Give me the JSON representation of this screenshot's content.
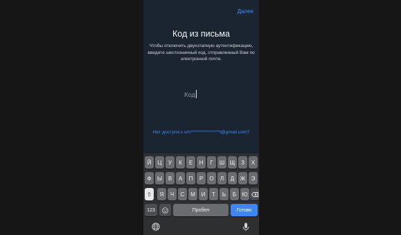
{
  "header": {
    "next_label": "Далее"
  },
  "main": {
    "title": "Код из письма",
    "subtitle": "Чтобы отключить двухэтапную аутентификацию, введите шестизначный код, отправленный Вам по электронной почте.",
    "code_placeholder": "Код",
    "no_access_link": "Нет доступа к sm****************l@gmail.com?"
  },
  "keyboard": {
    "row1": [
      "Й",
      "Ц",
      "У",
      "К",
      "Е",
      "Н",
      "Г",
      "Ш",
      "Щ",
      "З",
      "Х"
    ],
    "row2": [
      "Ф",
      "Ы",
      "В",
      "А",
      "П",
      "Р",
      "О",
      "Л",
      "Д",
      "Ж",
      "Э"
    ],
    "row3": [
      "Я",
      "Ч",
      "С",
      "М",
      "И",
      "Т",
      "Ь",
      "Б",
      "Ю"
    ],
    "numbers_label": "123",
    "space_label": "Пробел",
    "done_label": "Готово",
    "icons": [
      "shift-icon",
      "backspace-icon",
      "emoji-icon",
      "globe-icon",
      "microphone-icon"
    ]
  }
}
